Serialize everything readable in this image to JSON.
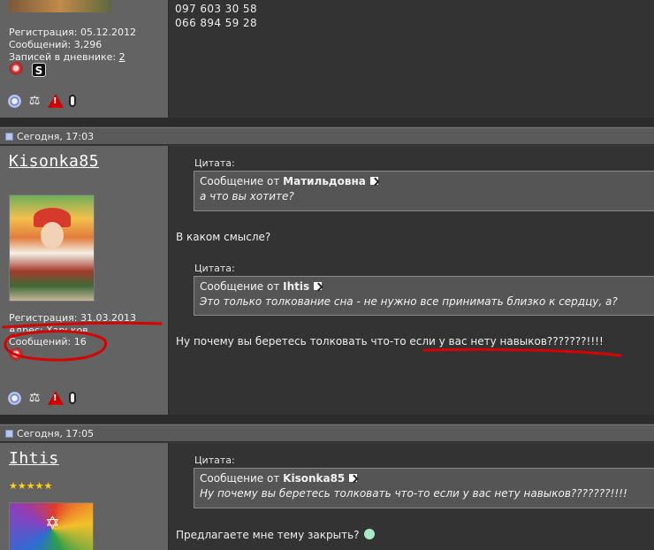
{
  "post0": {
    "reg": "Регистрация: 05.12.2012",
    "msgs": "Сообщений: 3,296",
    "diary_label": "Записей в дневнике:",
    "diary_count": "2",
    "phone1": "097 603 30 58",
    "phone2": "066 894 59 28"
  },
  "post1": {
    "date": "Сегодня, 17:03",
    "username": "Kisonka85",
    "reg": "Регистрация: 31.03.2013",
    "addr": "Адрес: Харьков",
    "msgs": "Сообщений: 16",
    "quote_label_1": "Цитата:",
    "quote1_from_prefix": "Сообщение от",
    "quote1_author": "Матильдовна",
    "quote1_text": "а что вы хотите?",
    "reply1": "В каком смысле?",
    "quote_label_2": "Цитата:",
    "quote2_from_prefix": "Сообщение от",
    "quote2_author": "Ihtis",
    "quote2_text": "Это только толкование сна - не нужно все принимать близко к сердцу, а?",
    "reply2": "Ну почему вы беретесь толковать что-то если у вас нету навыков???????!!!!"
  },
  "post2": {
    "date": "Сегодня, 17:05",
    "username": "Ihtis",
    "stars": "★★★★★",
    "quote_label": "Цитата:",
    "quote_from_prefix": "Сообщение от",
    "quote_author": "Kisonka85",
    "quote_text": "Ну почему вы беретесь толковать что-то если у вас нету навыков???????!!!!",
    "reply": "Предлагаете мне тему закрыть?"
  },
  "icons": {
    "radio": "radio-icon",
    "scale": "scale-icon",
    "warn": "warning-icon",
    "clip": "paperclip-icon",
    "flower": "flower-icon",
    "skype": "skype-icon",
    "arrow": "view-post-arrow-icon",
    "smile": "smiley-icon"
  },
  "colors": {
    "annotation_red": "#d60000",
    "left_bg": "#636363",
    "right_bg": "#333333"
  }
}
